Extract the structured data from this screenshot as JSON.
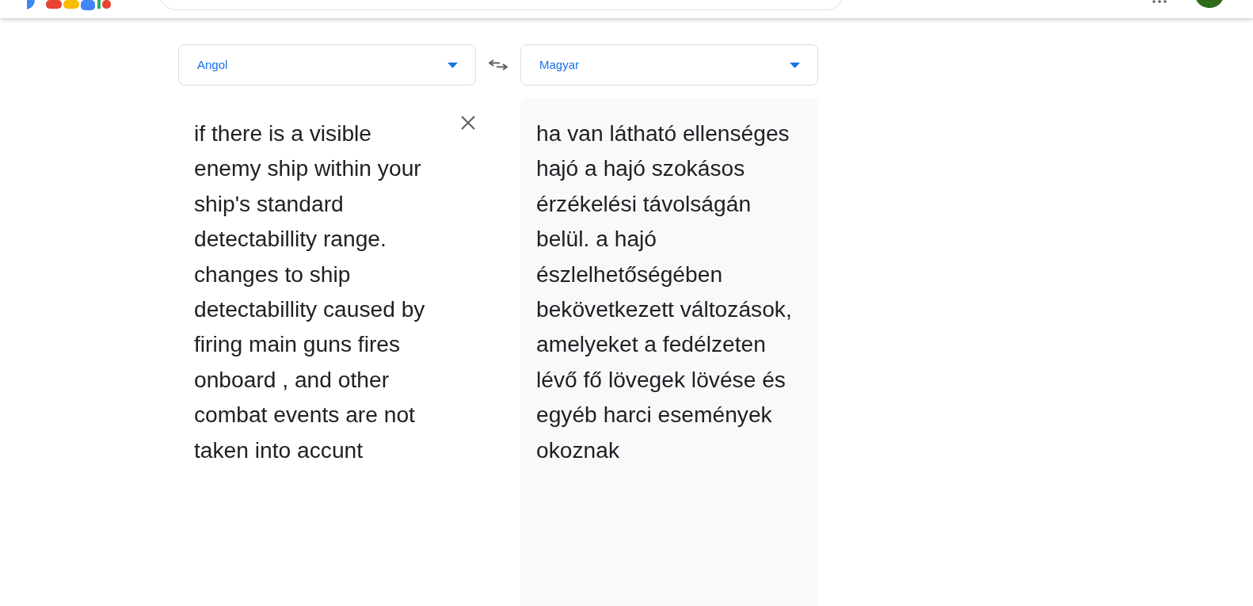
{
  "source": {
    "language": "Angol",
    "text": "if there is a visible enemy ship within your ship's standard detectabillity range. changes to ship detectabillity caused by firing main guns fires onboard , and other combat events are not taken into accunt"
  },
  "target": {
    "language": "Magyar",
    "text": "ha van látható ellenséges hajó a hajó szokásos érzékelési távolságán belül. a hajó észlelhetőségében bekövetkezett változások, amelyeket a fedélzeten lévő fő lövegek lövése és egyéb harci események okoznak"
  }
}
